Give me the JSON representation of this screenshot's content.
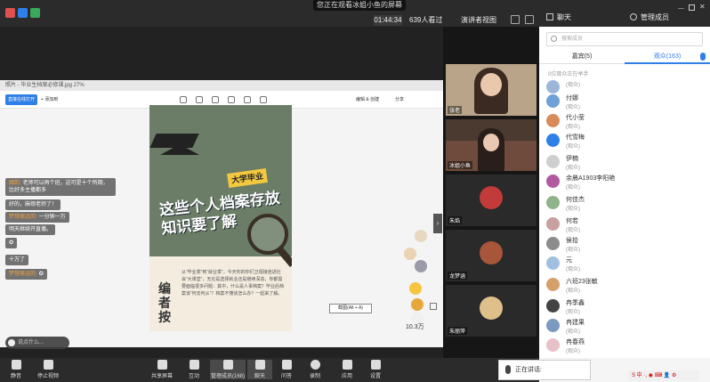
{
  "top_bar": {
    "notice": "您正在观看冰姐小鱼的屏幕",
    "clock": "01:44:34",
    "viewers": "639人看过",
    "view_mode": "演讲者视图"
  },
  "doc": {
    "window_title": "照片 - 毕业生档案必修课.jpg  27%",
    "open_button": "直接在线打开",
    "add_button": "+ 添加到",
    "edit_label": "编辑 & 创建",
    "share_label": "分享",
    "poster": {
      "tag": "大学毕业",
      "headline": "这些个人档案存放知识要了解",
      "editor_label": "编者按",
      "body": "从“毕业季”到“就业季”，今天你的你们卫视接连进社会“大课堂”，无论是选择就业还是继续深造，你都需要面临很多问题：其中，什么是人事档案？毕业后档案该“何去何从”？档案不懂该怎么办？一起来了解。"
    },
    "reaction_count": "10.3万",
    "screenshot_tip": "截图(Alt + A)"
  },
  "chat": {
    "messages": [
      {
        "nick": "嫣韵:",
        "text": "老师可以再个班，这可是十个所期，比好多主播都多"
      },
      {
        "nick": "",
        "text": "好的，麻烦老师了！"
      },
      {
        "nick": "梦想很远的:",
        "text": "一分钟一万"
      },
      {
        "nick": "",
        "text": "明天继续开直播。"
      },
      {
        "nick": "",
        "text": "✪"
      },
      {
        "nick": "",
        "text": "十万了"
      },
      {
        "nick": "梦想很远的:",
        "text": "✪"
      }
    ],
    "input_placeholder": "说点什么..."
  },
  "video_tiles": [
    {
      "label": "张老",
      "bg": "#b9a48a"
    },
    {
      "label": "冰姐小鱼",
      "bg": "#6e4b3c"
    },
    {
      "label": "朱焰",
      "bg": "#2a2a2a",
      "avatar_color": "#c23a3a"
    },
    {
      "label": "龙梦涵",
      "bg": "#2a2a2a",
      "avatar_color": "#a8563a"
    },
    {
      "label": "朱丽萍",
      "bg": "#2a2a2a",
      "avatar_color": "#e0c08a"
    }
  ],
  "side": {
    "tab_chat": "聊天",
    "tab_members": "管理成员",
    "search_placeholder": "搜索成员",
    "role_hosts": "嘉宾(5)",
    "role_audience": "观众(163)",
    "hand_note": "0位观众正在举手",
    "members": [
      {
        "name": "",
        "role": "(观众)",
        "color": "#9ab7d8"
      },
      {
        "name": "付娜",
        "role": "(观众)",
        "color": "#6fa0d6"
      },
      {
        "name": "代小莹",
        "role": "(观众)",
        "color": "#d88a5a"
      },
      {
        "name": "代雪梅",
        "role": "(观众)",
        "color": "#2f7fe8"
      },
      {
        "name": "伊楠",
        "role": "(观众)",
        "color": "#cfcfcf"
      },
      {
        "name": "余晨A1903李阳艳",
        "role": "(观众)",
        "color": "#b25aa0"
      },
      {
        "name": "何佳杰",
        "role": "(观众)",
        "color": "#8fb38a"
      },
      {
        "name": "何若",
        "role": "(观众)",
        "color": "#c8a0a0"
      },
      {
        "name": "侯拾",
        "role": "(观众)",
        "color": "#8c8c8c"
      },
      {
        "name": "元",
        "role": "(观众)",
        "color": "#a0c0e0"
      },
      {
        "name": "六班23张敏",
        "role": "(观众)",
        "color": "#d6a06a"
      },
      {
        "name": "冉季鑫",
        "role": "(观众)",
        "color": "#444"
      },
      {
        "name": "冉建果",
        "role": "(观众)",
        "color": "#7a9ac0"
      },
      {
        "name": "冉春燕",
        "role": "(观众)",
        "color": "#e8c0c8"
      }
    ]
  },
  "bottom_bar": {
    "tools": [
      {
        "icon": "microphone-icon",
        "label": "静音"
      },
      {
        "icon": "camera-icon",
        "label": "停止视频"
      },
      {
        "icon": "share-screen-icon",
        "label": "共享屏幕"
      },
      {
        "icon": "interact-icon",
        "label": "互动"
      },
      {
        "icon": "members-icon",
        "label": "管理成员(168)"
      },
      {
        "icon": "chat-icon",
        "label": "聊天"
      },
      {
        "icon": "question-icon",
        "label": "问答"
      },
      {
        "icon": "record-icon",
        "label": "录制"
      },
      {
        "icon": "apps-icon",
        "label": "应用"
      },
      {
        "icon": "settings-icon",
        "label": "设置"
      }
    ],
    "speaking": "正在讲话:",
    "ime": "S 中 ·, ◉ ⌨ 👤 ⚙"
  }
}
